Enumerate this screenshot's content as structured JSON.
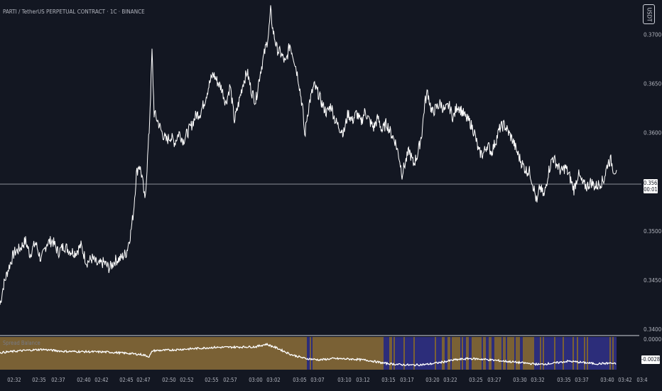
{
  "header": {
    "title": "PARTI / TetherUS PERPETUAL CONTRACT · 1C · BINANCE",
    "currency_badge": "USDT"
  },
  "price_marker": {
    "price": "0.3562",
    "countdown": "00:01"
  },
  "oscillator": {
    "label": "Spread Balance",
    "value_label": "-0.0028",
    "upper_tick": "0.0000",
    "colors": {
      "positive": "#7a6135",
      "negative": "#2c2d7a",
      "line": "#ffffff"
    }
  },
  "colors": {
    "background": "#131722",
    "line": "#ffffff",
    "axis_text": "#b2b5be",
    "grid": "#ffffff"
  },
  "chart_data": {
    "type": "line",
    "title": "PARTI / TetherUS PERPETUAL CONTRACT · 1C · BINANCE",
    "xlabel": "",
    "ylabel": "",
    "ylim": [
      0.3395,
      0.3735
    ],
    "grid": false,
    "y_ticks": [
      "0.3700",
      "0.3650",
      "0.3600",
      "0.3500",
      "0.3450",
      "0.3400"
    ],
    "x_ticks": [
      "02:32",
      "02:35",
      "02:37",
      "02:40",
      "02:42",
      "02:45",
      "02:47",
      "02:50",
      "02:52",
      "02:55",
      "02:57",
      "03:00",
      "03:02",
      "03:05",
      "03:07",
      "03:10",
      "03:12",
      "03:15",
      "03:17",
      "03:20",
      "03:22",
      "03:25",
      "03:27",
      "03:30",
      "03:32",
      "03:35",
      "03:37",
      "03:40",
      "03:42",
      "03:4"
    ],
    "series": [
      {
        "values": [
          [
            0,
            0.3425
          ],
          [
            5,
            0.3445
          ],
          [
            12,
            0.3462
          ],
          [
            20,
            0.3478
          ],
          [
            28,
            0.3482
          ],
          [
            36,
            0.349
          ],
          [
            42,
            0.3476
          ],
          [
            50,
            0.3488
          ],
          [
            58,
            0.347
          ],
          [
            66,
            0.3488
          ],
          [
            74,
            0.349
          ],
          [
            82,
            0.3478
          ],
          [
            90,
            0.3485
          ],
          [
            98,
            0.348
          ],
          [
            106,
            0.3478
          ],
          [
            114,
            0.3485
          ],
          [
            122,
            0.3468
          ],
          [
            130,
            0.3472
          ],
          [
            138,
            0.3465
          ],
          [
            146,
            0.3468
          ],
          [
            154,
            0.3462
          ],
          [
            162,
            0.347
          ],
          [
            170,
            0.3472
          ],
          [
            178,
            0.3478
          ],
          [
            184,
            0.3498
          ],
          [
            188,
            0.352
          ],
          [
            192,
            0.3558
          ],
          [
            196,
            0.3568
          ],
          [
            200,
            0.3555
          ],
          [
            204,
            0.353
          ],
          [
            207,
            0.3565
          ],
          [
            210,
            0.3602
          ],
          [
            212,
            0.364
          ],
          [
            214,
            0.3682
          ],
          [
            217,
            0.362
          ],
          [
            222,
            0.3612
          ],
          [
            228,
            0.36
          ],
          [
            234,
            0.3592
          ],
          [
            240,
            0.3596
          ],
          [
            246,
            0.359
          ],
          [
            252,
            0.36
          ],
          [
            258,
            0.3592
          ],
          [
            264,
            0.36
          ],
          [
            270,
            0.3608
          ],
          [
            276,
            0.3618
          ],
          [
            282,
            0.362
          ],
          [
            288,
            0.3632
          ],
          [
            294,
            0.3648
          ],
          [
            300,
            0.366
          ],
          [
            306,
            0.3652
          ],
          [
            312,
            0.3645
          ],
          [
            318,
            0.363
          ],
          [
            324,
            0.3648
          ],
          [
            330,
            0.3612
          ],
          [
            336,
            0.363
          ],
          [
            342,
            0.365
          ],
          [
            348,
            0.3662
          ],
          [
            354,
            0.3642
          ],
          [
            360,
            0.3632
          ],
          [
            366,
            0.366
          ],
          [
            372,
            0.368
          ],
          [
            378,
            0.37
          ],
          [
            381,
            0.3724
          ],
          [
            384,
            0.3705
          ],
          [
            390,
            0.3685
          ],
          [
            396,
            0.368
          ],
          [
            402,
            0.367
          ],
          [
            408,
            0.369
          ],
          [
            414,
            0.3675
          ],
          [
            420,
            0.3655
          ],
          [
            426,
            0.3625
          ],
          [
            429,
            0.3596
          ],
          [
            432,
            0.3615
          ],
          [
            436,
            0.3632
          ],
          [
            442,
            0.3648
          ],
          [
            448,
            0.364
          ],
          [
            454,
            0.3628
          ],
          [
            460,
            0.362
          ],
          [
            466,
            0.3628
          ],
          [
            472,
            0.3612
          ],
          [
            478,
            0.3605
          ],
          [
            484,
            0.36
          ],
          [
            490,
            0.362
          ],
          [
            496,
            0.3612
          ],
          [
            502,
            0.362
          ],
          [
            508,
            0.361
          ],
          [
            514,
            0.3622
          ],
          [
            520,
            0.3612
          ],
          [
            526,
            0.3605
          ],
          [
            532,
            0.3615
          ],
          [
            538,
            0.3602
          ],
          [
            544,
            0.361
          ],
          [
            550,
            0.36
          ],
          [
            556,
            0.3592
          ],
          [
            562,
            0.3575
          ],
          [
            566,
            0.3558
          ],
          [
            570,
            0.3568
          ],
          [
            576,
            0.3582
          ],
          [
            582,
            0.3568
          ],
          [
            588,
            0.3578
          ],
          [
            594,
            0.36
          ],
          [
            598,
            0.363
          ],
          [
            602,
            0.3642
          ],
          [
            608,
            0.362
          ],
          [
            614,
            0.3625
          ],
          [
            620,
            0.363
          ],
          [
            626,
            0.3622
          ],
          [
            632,
            0.3628
          ],
          [
            638,
            0.3615
          ],
          [
            644,
            0.3628
          ],
          [
            650,
            0.3622
          ],
          [
            656,
            0.3615
          ],
          [
            662,
            0.361
          ],
          [
            668,
            0.36
          ],
          [
            674,
            0.358
          ],
          [
            680,
            0.3578
          ],
          [
            686,
            0.3588
          ],
          [
            692,
            0.358
          ],
          [
            698,
            0.3592
          ],
          [
            704,
            0.3605
          ],
          [
            710,
            0.3608
          ],
          [
            716,
            0.36
          ],
          [
            722,
            0.3592
          ],
          [
            728,
            0.358
          ],
          [
            734,
            0.357
          ],
          [
            740,
            0.3562
          ],
          [
            746,
            0.356
          ],
          [
            752,
            0.3542
          ],
          [
            756,
            0.3528
          ],
          [
            760,
            0.3545
          ],
          [
            766,
            0.3535
          ],
          [
            772,
            0.356
          ],
          [
            778,
            0.3575
          ],
          [
            784,
            0.3568
          ],
          [
            790,
            0.356
          ],
          [
            796,
            0.3565
          ],
          [
            802,
            0.3555
          ],
          [
            808,
            0.3542
          ],
          [
            814,
            0.3558
          ],
          [
            820,
            0.3548
          ],
          [
            826,
            0.3545
          ],
          [
            832,
            0.355
          ],
          [
            838,
            0.3545
          ],
          [
            844,
            0.3548
          ],
          [
            850,
            0.3552
          ],
          [
            856,
            0.357
          ],
          [
            860,
            0.3572
          ],
          [
            864,
            0.3562
          ],
          [
            868,
            0.3562
          ]
        ]
      }
    ],
    "oscillator_series": {
      "name": "Spread Balance",
      "values": [
        [
          0,
          0.52
        ],
        [
          30,
          0.58
        ],
        [
          60,
          0.62
        ],
        [
          90,
          0.56
        ],
        [
          120,
          0.55
        ],
        [
          150,
          0.54
        ],
        [
          180,
          0.5
        ],
        [
          200,
          0.46
        ],
        [
          210,
          0.4
        ],
        [
          215,
          0.58
        ],
        [
          240,
          0.6
        ],
        [
          270,
          0.64
        ],
        [
          300,
          0.68
        ],
        [
          330,
          0.69
        ],
        [
          360,
          0.7
        ],
        [
          375,
          0.78
        ],
        [
          390,
          0.66
        ],
        [
          410,
          0.46
        ],
        [
          430,
          0.34
        ],
        [
          450,
          0.3
        ],
        [
          470,
          0.34
        ],
        [
          500,
          0.32
        ],
        [
          520,
          0.28
        ],
        [
          540,
          0.2
        ],
        [
          560,
          0.16
        ],
        [
          580,
          0.14
        ],
        [
          600,
          0.16
        ],
        [
          620,
          0.22
        ],
        [
          640,
          0.3
        ],
        [
          660,
          0.34
        ],
        [
          680,
          0.32
        ],
        [
          700,
          0.28
        ],
        [
          720,
          0.24
        ],
        [
          740,
          0.2
        ],
        [
          760,
          0.16
        ],
        [
          780,
          0.2
        ],
        [
          800,
          0.26
        ],
        [
          820,
          0.22
        ],
        [
          840,
          0.18
        ],
        [
          860,
          0.2
        ],
        [
          868,
          0.17
        ]
      ]
    }
  }
}
